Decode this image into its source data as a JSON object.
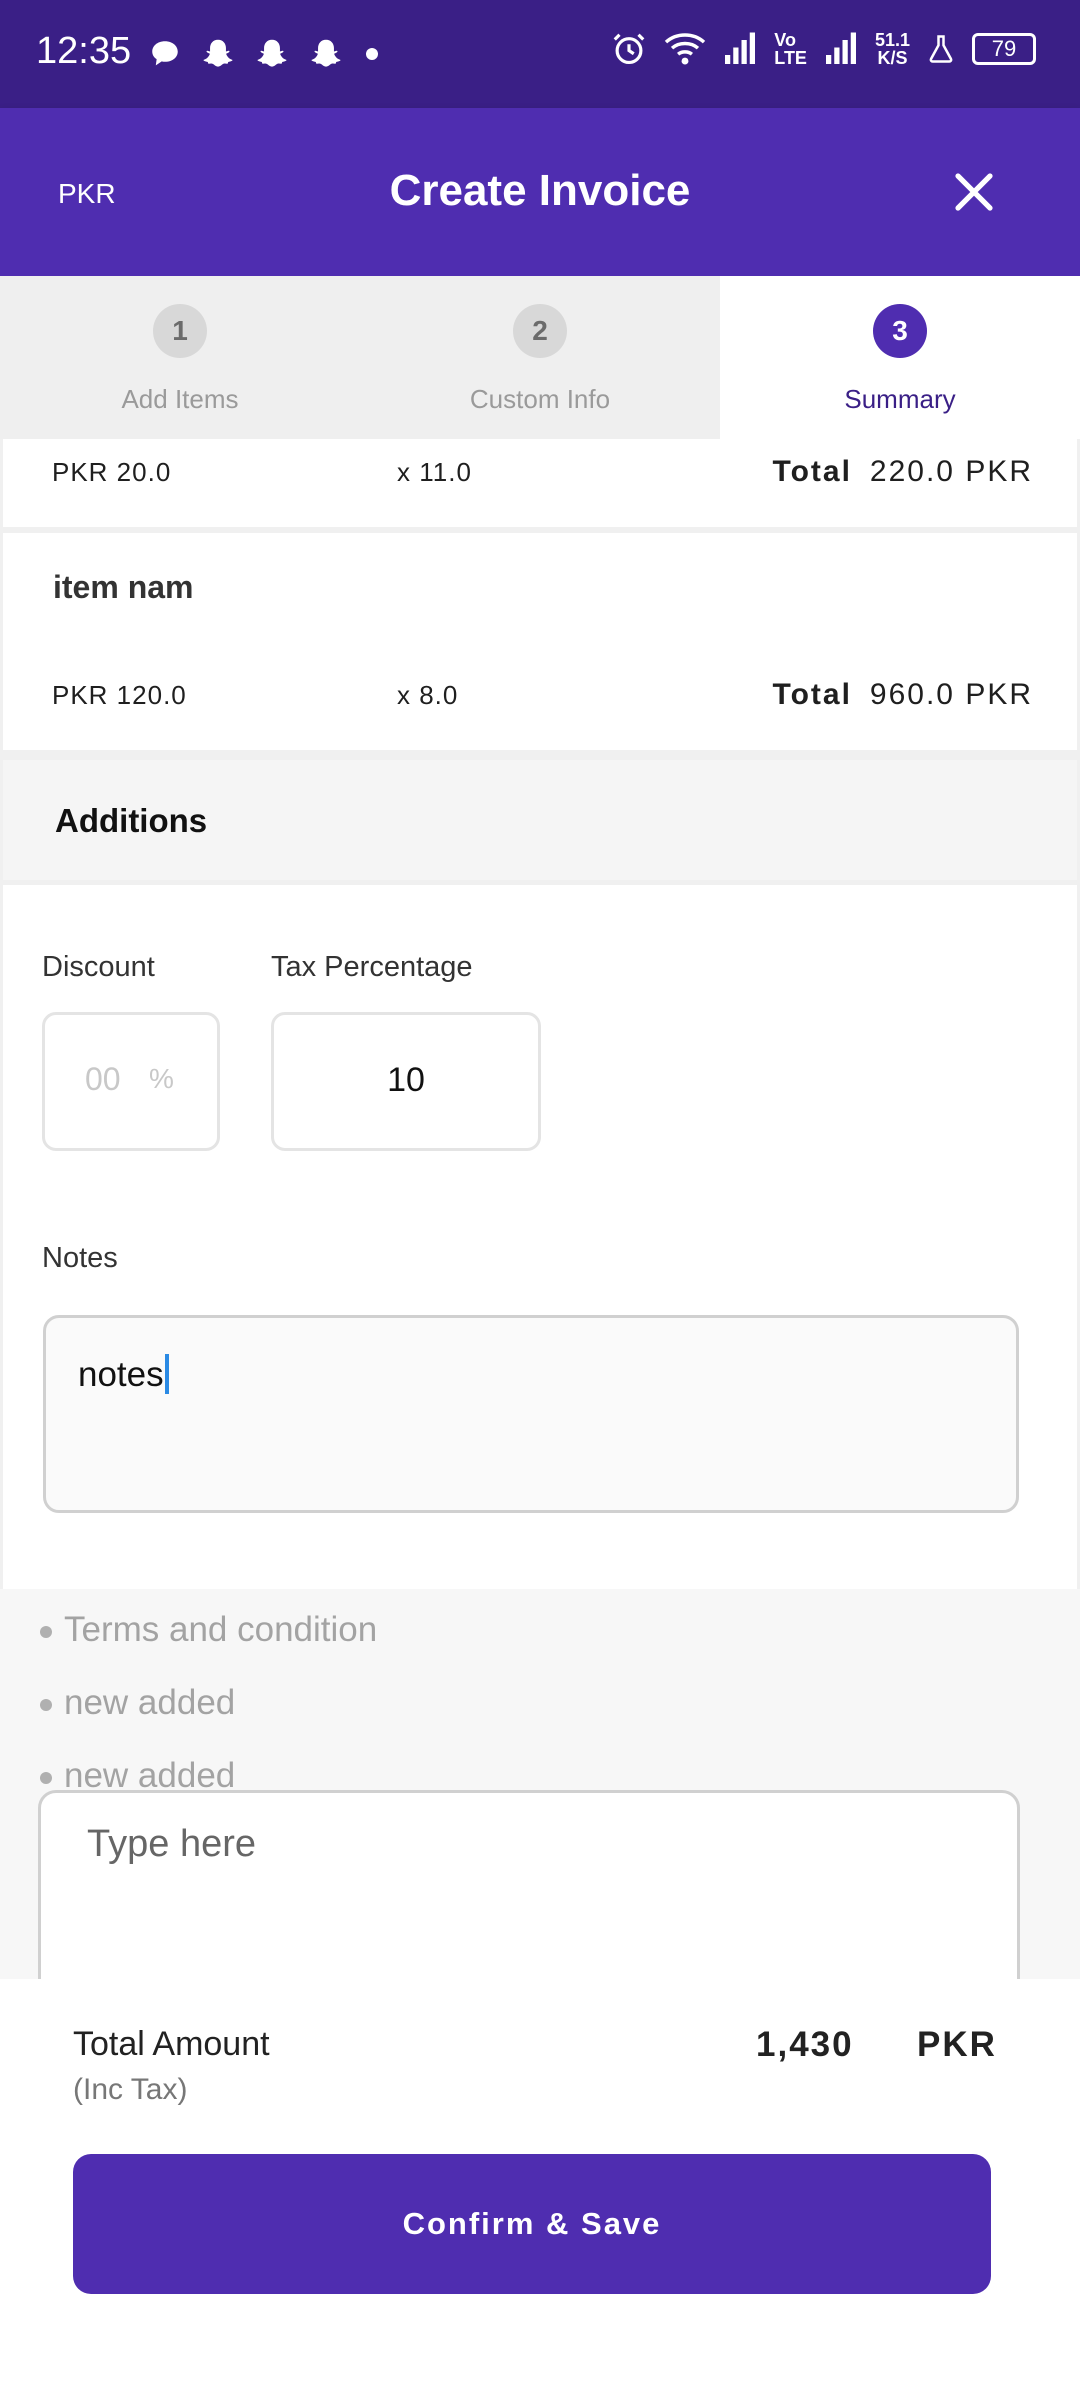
{
  "status_bar": {
    "time": "12:35",
    "network_speed_value": "51.1",
    "network_speed_unit": "K/S",
    "volte_top": "Vo",
    "volte_bottom": "LTE",
    "battery": "79"
  },
  "app_bar": {
    "currency": "PKR",
    "title": "Create Invoice"
  },
  "steps": [
    {
      "number": "1",
      "label": "Add Items",
      "active": false
    },
    {
      "number": "2",
      "label": "Custom Info",
      "active": false
    },
    {
      "number": "3",
      "label": "Summary",
      "active": true
    }
  ],
  "items": [
    {
      "price": "PKR 20.0",
      "quantity": "x 11.0",
      "total_label": "Total",
      "total": "220.0 PKR"
    },
    {
      "name": "item nam",
      "price": "PKR 120.0",
      "quantity": "x 8.0",
      "total_label": "Total",
      "total": "960.0 PKR"
    }
  ],
  "additions": {
    "heading": "Additions",
    "discount_label": "Discount",
    "discount_placeholder": "00",
    "discount_suffix": "%",
    "tax_label": "Tax Percentage",
    "tax_value": "10"
  },
  "notes": {
    "label": "Notes",
    "value": "notes"
  },
  "terms": {
    "items": [
      "Terms and condition",
      "new added",
      "new added"
    ],
    "input_placeholder": "Type here"
  },
  "summary": {
    "total_label": "Total Amount",
    "inc_tax": "(Inc Tax)",
    "amount": "1,430",
    "currency": "PKR",
    "confirm_label": "Confirm & Save"
  },
  "colors": {
    "status_bar": "#3a1f86",
    "primary": "#4f2db0",
    "caret": "#2a8ae4"
  }
}
